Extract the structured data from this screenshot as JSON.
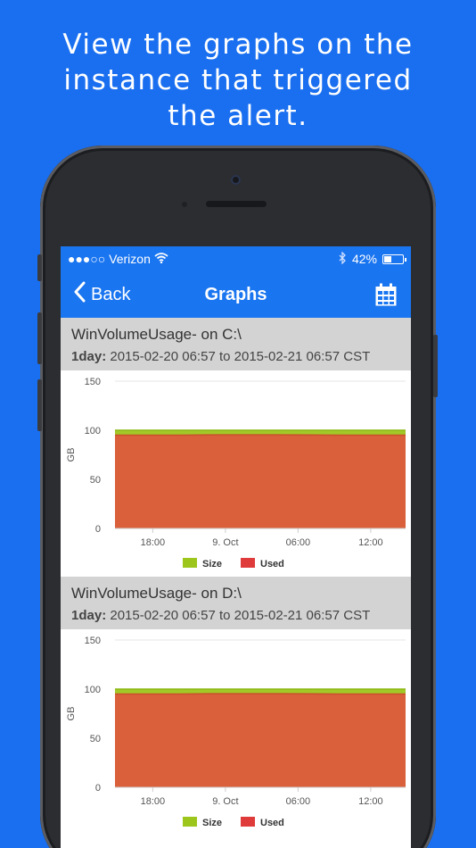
{
  "headline": [
    "View the graphs on the",
    "instance that triggered",
    "the alert."
  ],
  "status_bar": {
    "carrier": "●●●○○ Verizon",
    "battery": "42%",
    "battery_level": 0.42
  },
  "nav": {
    "back_label": "Back",
    "title": "Graphs",
    "right_icon": "calendar-icon"
  },
  "graphs": [
    {
      "title": "WinVolumeUsage- on C:\\",
      "range_prefix": "1day:",
      "range_text": " 2015-02-20 06:57 to 2015-02-21 06:57 CST"
    },
    {
      "title": "WinVolumeUsage- on D:\\",
      "range_prefix": "1day:",
      "range_text": " 2015-02-20 06:57 to 2015-02-21 06:57 CST"
    }
  ],
  "colors": {
    "background": "#1a6ff0",
    "nav": "#1a75f0",
    "size_series": "#9dc61c",
    "used_series": "#d9603a",
    "used_legend": "#e03b3b"
  },
  "chart_data": [
    {
      "type": "area",
      "title": "",
      "ylabel": "GB",
      "xlabel": "",
      "ylim": [
        0,
        150
      ],
      "yticks": [
        0,
        50,
        100,
        150
      ],
      "xticks": [
        "18:00",
        "9. Oct",
        "06:00",
        "12:00"
      ],
      "grid": true,
      "legend_position": "bottom",
      "series": [
        {
          "name": "Size",
          "values": [
            100,
            100,
            100,
            100,
            100,
            100,
            100,
            100,
            100,
            100
          ],
          "color": "#9dc61c"
        },
        {
          "name": "Used",
          "values": [
            95,
            95,
            95,
            95.3,
            95.3,
            95.3,
            95.2,
            95,
            95,
            95
          ],
          "color": "#d9603a"
        }
      ]
    },
    {
      "type": "area",
      "title": "",
      "ylabel": "GB",
      "xlabel": "",
      "ylim": [
        0,
        150
      ],
      "yticks": [
        0,
        50,
        100,
        150
      ],
      "xticks": [
        "18:00",
        "9. Oct",
        "06:00",
        "12:00"
      ],
      "grid": true,
      "legend_position": "bottom",
      "series": [
        {
          "name": "Size",
          "values": [
            100,
            100,
            100,
            100,
            100,
            100,
            100,
            100,
            100,
            100
          ],
          "color": "#9dc61c"
        },
        {
          "name": "Used",
          "values": [
            95,
            95,
            95,
            95.3,
            95.3,
            95.3,
            95.2,
            95,
            95,
            95
          ],
          "color": "#d9603a"
        }
      ]
    }
  ]
}
